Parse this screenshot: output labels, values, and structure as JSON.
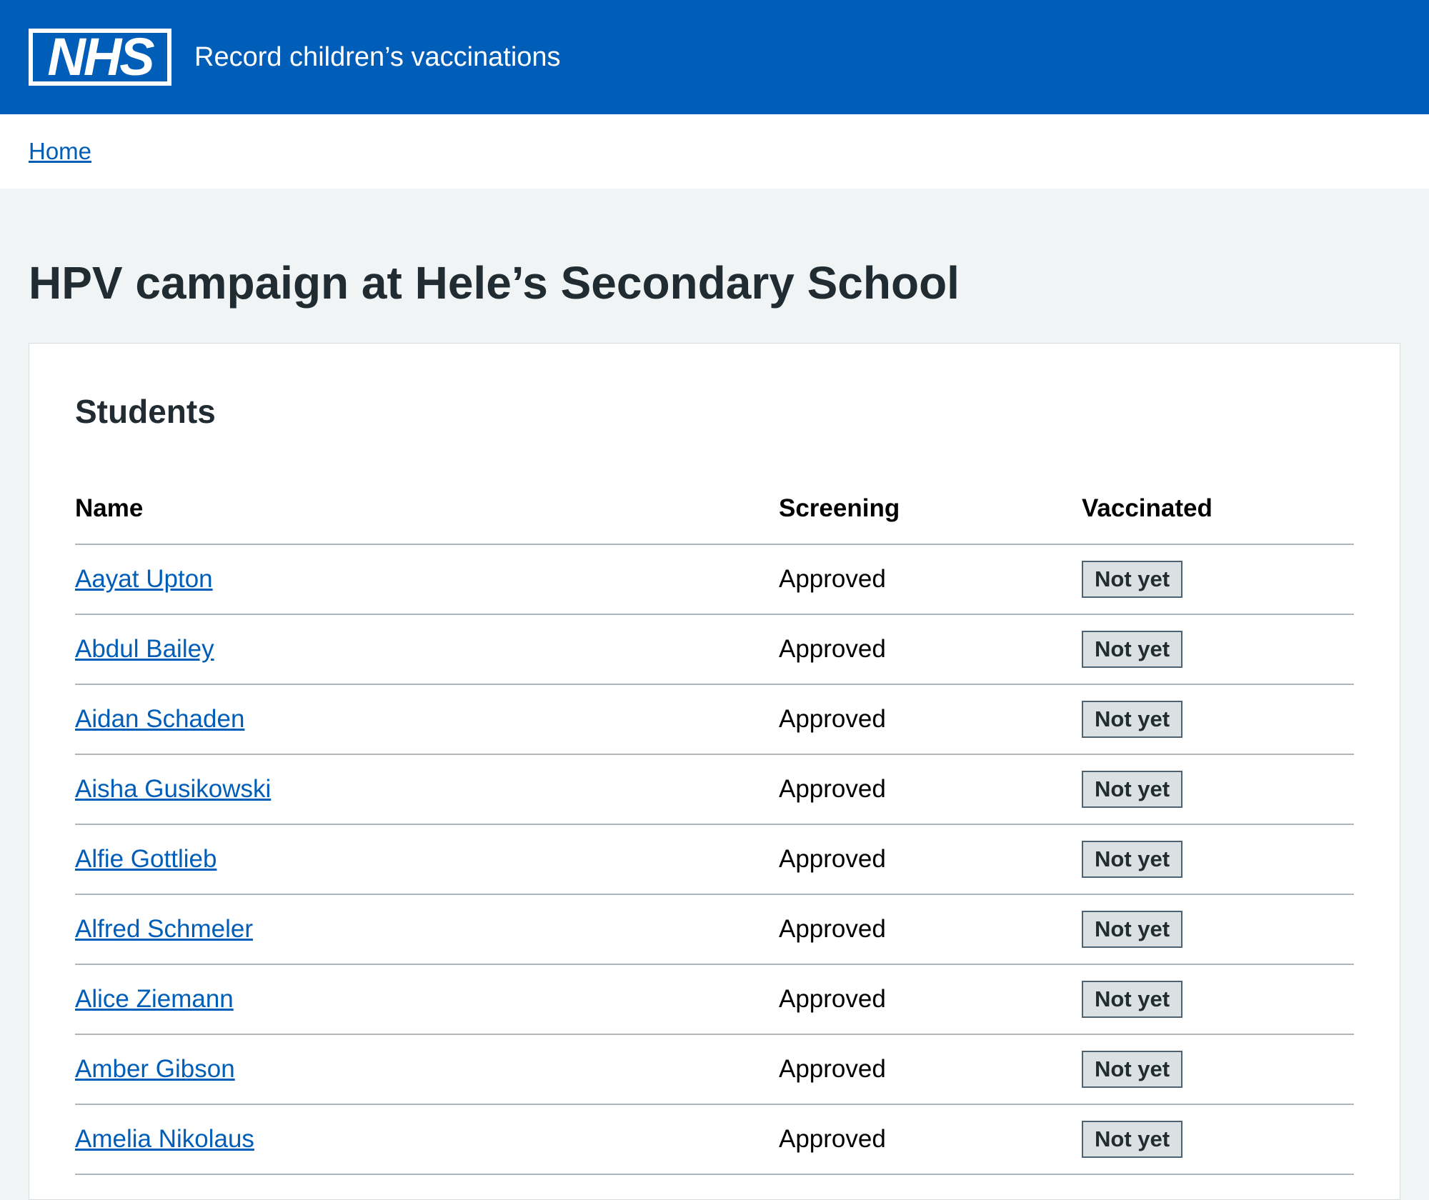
{
  "header": {
    "logo_text": "NHS",
    "service_name": "Record children’s vaccinations"
  },
  "breadcrumb": {
    "home_label": "Home"
  },
  "page": {
    "title": "HPV campaign at Hele’s Secondary School"
  },
  "students_card": {
    "heading": "Students",
    "columns": [
      "Name",
      "Screening",
      "Vaccinated"
    ],
    "rows": [
      {
        "name": "Aayat Upton",
        "screening": "Approved",
        "vaccinated": "Not yet"
      },
      {
        "name": "Abdul Bailey",
        "screening": "Approved",
        "vaccinated": "Not yet"
      },
      {
        "name": "Aidan Schaden",
        "screening": "Approved",
        "vaccinated": "Not yet"
      },
      {
        "name": "Aisha Gusikowski",
        "screening": "Approved",
        "vaccinated": "Not yet"
      },
      {
        "name": "Alfie Gottlieb",
        "screening": "Approved",
        "vaccinated": "Not yet"
      },
      {
        "name": "Alfred Schmeler",
        "screening": "Approved",
        "vaccinated": "Not yet"
      },
      {
        "name": "Alice Ziemann",
        "screening": "Approved",
        "vaccinated": "Not yet"
      },
      {
        "name": "Amber Gibson",
        "screening": "Approved",
        "vaccinated": "Not yet"
      },
      {
        "name": "Amelia Nikolaus",
        "screening": "Approved",
        "vaccinated": "Not yet"
      }
    ]
  },
  "colors": {
    "nhs_blue": "#005eb8",
    "page_background": "#f0f4f5",
    "tag_background": "#dbe0e3",
    "tag_border": "#4c6272"
  }
}
